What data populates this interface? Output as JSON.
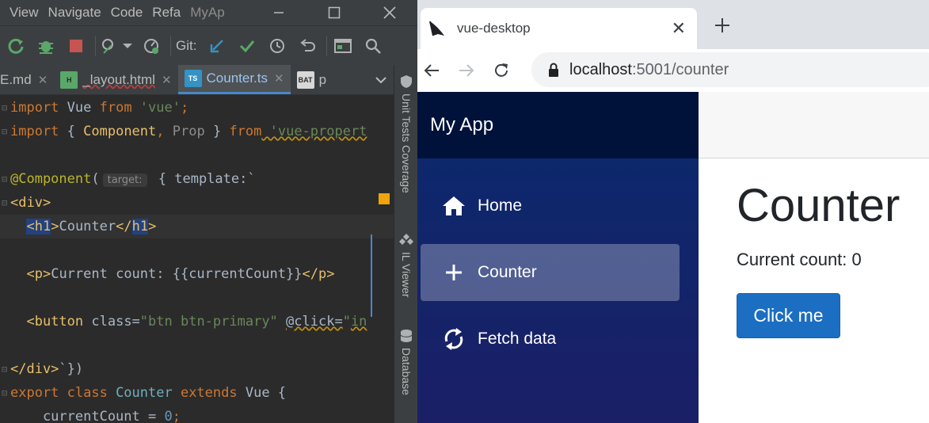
{
  "ide": {
    "menu": [
      "View",
      "Navigate",
      "Code",
      "Refa"
    ],
    "app_title": "MyAp",
    "git_label": "Git:",
    "tabs": [
      {
        "label": "E.md",
        "active": false
      },
      {
        "label": "_layout.html",
        "active": false
      },
      {
        "label": "Counter.ts",
        "active": true
      },
      {
        "label": "p",
        "active": false
      }
    ],
    "code": {
      "l1_kw_import": "import",
      "l1_name": " Vue ",
      "l1_kw_from": "from",
      "l1_str": " 'vue'",
      "l1_end": ";",
      "l2_kw_import": "import",
      "l2_open": " { ",
      "l2_comp": "Component",
      "l2_comma": ", ",
      "l2_prop": "Prop",
      "l2_close": " } ",
      "l2_kw_from": "from",
      "l2_str": " 'vue-propert",
      "l3_ann": "@Component",
      "l3_paren": "(",
      "l3_hint": "target:",
      "l3_rest": " { template:`",
      "l4": "<div>",
      "l5_lt": "<",
      "l5_tag": "h1",
      "l5_gt": ">",
      "l5_text": "Counter",
      "l5_close_lt": "</",
      "l5_close_tag": "h1",
      "l5_close_gt": ">",
      "l6_open": "<p>",
      "l6_text": "Current count: {{currentCount}}",
      "l6_close": "</p>",
      "l7_tag": "<button ",
      "l7_attr": "class=",
      "l7_val": "\"btn btn-primary\" ",
      "l7_click": "@click=",
      "l7_quote": "\"",
      "l7_in": "in",
      "l8_tag": "</div>",
      "l8_rest": "`})",
      "l9_kw": "export class ",
      "l9_name": "Counter ",
      "l9_kw2": "extends ",
      "l9_rest": "Vue {",
      "l10_name": "    currentCount = ",
      "l10_num": "0",
      "l10_end": ";"
    },
    "side_tabs": [
      "Unit Tests Coverage",
      "IL Viewer",
      "Database"
    ]
  },
  "browser": {
    "tab_title": "vue-desktop",
    "url_host": "localhost",
    "url_path": ":5001/counter",
    "app_name": "My App",
    "nav": [
      {
        "label": "Home",
        "icon": "home-icon",
        "active": false
      },
      {
        "label": "Counter",
        "icon": "plus-icon",
        "active": true
      },
      {
        "label": "Fetch data",
        "icon": "sync-icon",
        "active": false
      }
    ],
    "heading": "Counter",
    "current_count": "Current count: 0",
    "button_label": "Click me"
  },
  "colors": {
    "ide_bg": "#2b2b2b",
    "ide_chrome": "#3c3f41",
    "sidebar_top": "#00123a",
    "sidebar_bg": "#0a2a6e",
    "primary_button": "#1b6ec2"
  }
}
